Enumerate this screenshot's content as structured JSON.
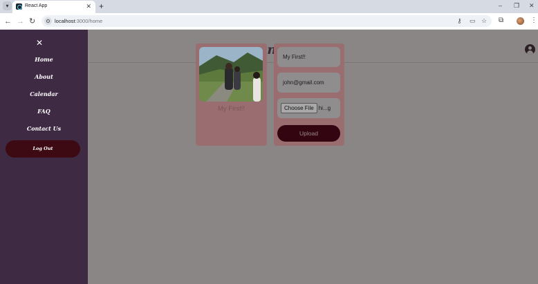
{
  "browser": {
    "tab_title": "React App",
    "new_tab_symbol": "+",
    "url_host": "localhost",
    "url_path": ":3000/home"
  },
  "app": {
    "brand": "glimpses"
  },
  "sidebar": {
    "close_symbol": "✕",
    "items": [
      {
        "label": "Home"
      },
      {
        "label": "About"
      },
      {
        "label": "Calendar"
      },
      {
        "label": "FAQ"
      },
      {
        "label": "Contact Us"
      }
    ],
    "logout_label": "Log Out"
  },
  "post": {
    "caption": "My First!!"
  },
  "upload_form": {
    "title_value": "My First!!",
    "email_value": "john@gmail.com",
    "choose_file_label": "Choose File",
    "file_name": "hi...g",
    "upload_label": "Upload"
  },
  "colors": {
    "sidebar_bg": "#3f2a44",
    "card_bg": "#9a6e71",
    "button_dark": "#330510",
    "page_overlay": "#8a8686"
  }
}
